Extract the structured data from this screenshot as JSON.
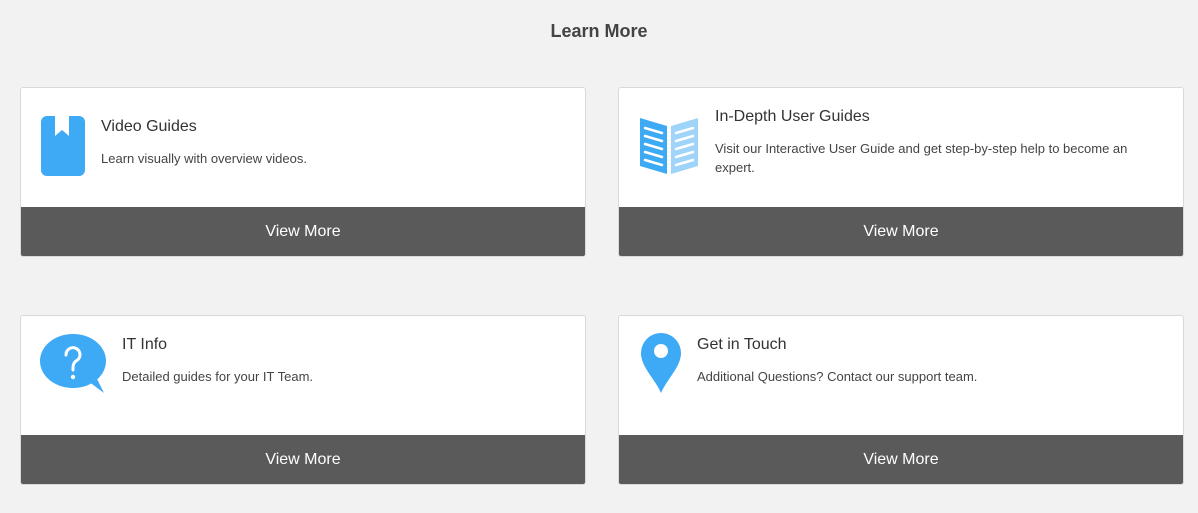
{
  "page": {
    "title": "Learn More"
  },
  "colors": {
    "accent": "#3ea9f5",
    "accent_light": "#9fd4fa",
    "button_bg": "#5a5a5a",
    "page_bg": "#f2f2f2"
  },
  "cards": [
    {
      "icon": "bookmark-book-icon",
      "title": "Video Guides",
      "description": "Learn visually with overview videos.",
      "button_label": "View More"
    },
    {
      "icon": "open-book-icon",
      "title": "In-Depth User Guides",
      "description": "Visit our Interactive User Guide and get step-by-step help to become an expert.",
      "button_label": "View More"
    },
    {
      "icon": "question-bubble-icon",
      "title": "IT Info",
      "description": "Detailed guides for your IT Team.",
      "button_label": "View More"
    },
    {
      "icon": "location-pin-icon",
      "title": "Get in Touch",
      "description": "Additional Questions? Contact our support team.",
      "button_label": "View More"
    }
  ]
}
